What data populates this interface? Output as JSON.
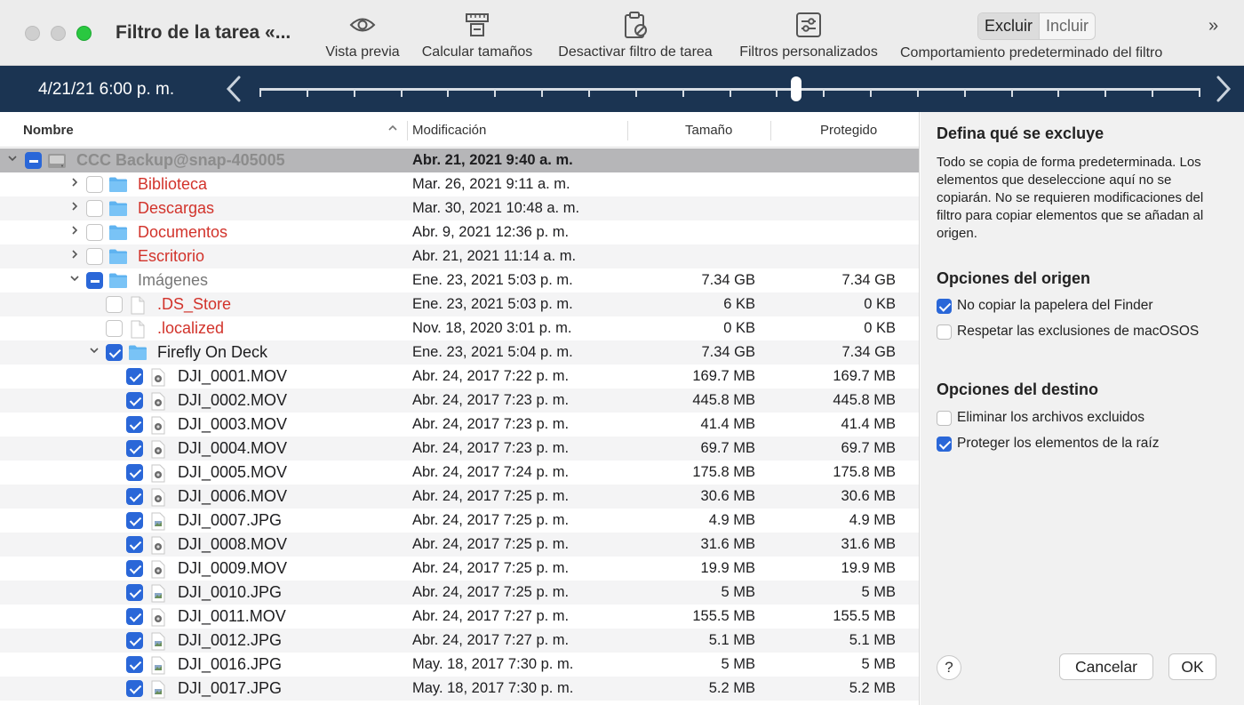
{
  "window": {
    "title": "Filtro de la tarea «..."
  },
  "toolbar": {
    "preview": "Vista previa",
    "calc_sizes": "Calcular tamaños",
    "disable_filter": "Desactivar filtro de tarea",
    "custom_filters": "Filtros personalizados",
    "exclude": "Excluir",
    "include": "Incluir",
    "default_behavior": "Comportamiento predeterminado del filtro"
  },
  "timeline": {
    "date": "4/21/21 6:00 p. m.",
    "position": 0.57
  },
  "columns": {
    "name": "Nombre",
    "modified": "Modificación",
    "size": "Tamaño",
    "protected": "Protegido"
  },
  "rows": [
    {
      "indent": 0,
      "disc": "down",
      "check": "mixed",
      "icon": "disk",
      "name": "CCC Backup@snap-405005",
      "date": "Abr. 21, 2021 9:40 a. m.",
      "size": "",
      "prot": "",
      "style": "disk",
      "sel": true
    },
    {
      "indent": 1,
      "disc": "right",
      "check": "none",
      "icon": "folder",
      "name": "Biblioteca",
      "date": "Mar. 26, 2021 9:11 a. m.",
      "size": "",
      "prot": "",
      "style": "red"
    },
    {
      "indent": 1,
      "disc": "right",
      "check": "none",
      "icon": "folder",
      "name": "Descargas",
      "date": "Mar. 30, 2021 10:48 a. m.",
      "size": "",
      "prot": "",
      "style": "red"
    },
    {
      "indent": 1,
      "disc": "right",
      "check": "none",
      "icon": "folder",
      "name": "Documentos",
      "date": "Abr. 9, 2021 12:36 p. m.",
      "size": "",
      "prot": "",
      "style": "red"
    },
    {
      "indent": 1,
      "disc": "right",
      "check": "none",
      "icon": "folder",
      "name": "Escritorio",
      "date": "Abr. 21, 2021 11:14 a. m.",
      "size": "",
      "prot": "",
      "style": "red"
    },
    {
      "indent": 1,
      "disc": "down",
      "check": "mixed",
      "icon": "folder",
      "name": "Imágenes",
      "date": "Ene. 23, 2021 5:03 p. m.",
      "size": "7.34 GB",
      "prot": "7.34 GB",
      "style": "grey"
    },
    {
      "indent": 2,
      "disc": "",
      "check": "none",
      "icon": "doc",
      "name": ".DS_Store",
      "date": "Ene. 23, 2021 5:03 p. m.",
      "size": "6 KB",
      "prot": "0 KB",
      "style": "red"
    },
    {
      "indent": 2,
      "disc": "",
      "check": "none",
      "icon": "doc",
      "name": ".localized",
      "date": "Nov. 18, 2020 3:01 p. m.",
      "size": "0 KB",
      "prot": "0 KB",
      "style": "red"
    },
    {
      "indent": 2,
      "disc": "down",
      "check": "checked",
      "icon": "folder",
      "name": "Firefly On Deck",
      "date": "Ene. 23, 2021 5:04 p. m.",
      "size": "7.34 GB",
      "prot": "7.34 GB",
      "style": "normal"
    },
    {
      "indent": 3,
      "disc": "",
      "check": "checked",
      "icon": "movie",
      "name": "DJI_0001.MOV",
      "date": "Abr. 24, 2017 7:22 p. m.",
      "size": "169.7 MB",
      "prot": "169.7 MB",
      "style": "normal"
    },
    {
      "indent": 3,
      "disc": "",
      "check": "checked",
      "icon": "movie",
      "name": "DJI_0002.MOV",
      "date": "Abr. 24, 2017 7:23 p. m.",
      "size": "445.8 MB",
      "prot": "445.8 MB",
      "style": "normal"
    },
    {
      "indent": 3,
      "disc": "",
      "check": "checked",
      "icon": "movie",
      "name": "DJI_0003.MOV",
      "date": "Abr. 24, 2017 7:23 p. m.",
      "size": "41.4 MB",
      "prot": "41.4 MB",
      "style": "normal"
    },
    {
      "indent": 3,
      "disc": "",
      "check": "checked",
      "icon": "movie",
      "name": "DJI_0004.MOV",
      "date": "Abr. 24, 2017 7:23 p. m.",
      "size": "69.7 MB",
      "prot": "69.7 MB",
      "style": "normal"
    },
    {
      "indent": 3,
      "disc": "",
      "check": "checked",
      "icon": "movie",
      "name": "DJI_0005.MOV",
      "date": "Abr. 24, 2017 7:24 p. m.",
      "size": "175.8 MB",
      "prot": "175.8 MB",
      "style": "normal"
    },
    {
      "indent": 3,
      "disc": "",
      "check": "checked",
      "icon": "movie",
      "name": "DJI_0006.MOV",
      "date": "Abr. 24, 2017 7:25 p. m.",
      "size": "30.6 MB",
      "prot": "30.6 MB",
      "style": "normal"
    },
    {
      "indent": 3,
      "disc": "",
      "check": "checked",
      "icon": "image",
      "name": "DJI_0007.JPG",
      "date": "Abr. 24, 2017 7:25 p. m.",
      "size": "4.9 MB",
      "prot": "4.9 MB",
      "style": "normal"
    },
    {
      "indent": 3,
      "disc": "",
      "check": "checked",
      "icon": "movie",
      "name": "DJI_0008.MOV",
      "date": "Abr. 24, 2017 7:25 p. m.",
      "size": "31.6 MB",
      "prot": "31.6 MB",
      "style": "normal"
    },
    {
      "indent": 3,
      "disc": "",
      "check": "checked",
      "icon": "movie",
      "name": "DJI_0009.MOV",
      "date": "Abr. 24, 2017 7:25 p. m.",
      "size": "19.9 MB",
      "prot": "19.9 MB",
      "style": "normal"
    },
    {
      "indent": 3,
      "disc": "",
      "check": "checked",
      "icon": "image",
      "name": "DJI_0010.JPG",
      "date": "Abr. 24, 2017 7:25 p. m.",
      "size": "5 MB",
      "prot": "5 MB",
      "style": "normal"
    },
    {
      "indent": 3,
      "disc": "",
      "check": "checked",
      "icon": "movie",
      "name": "DJI_0011.MOV",
      "date": "Abr. 24, 2017 7:27 p. m.",
      "size": "155.5 MB",
      "prot": "155.5 MB",
      "style": "normal"
    },
    {
      "indent": 3,
      "disc": "",
      "check": "checked",
      "icon": "image",
      "name": "DJI_0012.JPG",
      "date": "Abr. 24, 2017 7:27 p. m.",
      "size": "5.1 MB",
      "prot": "5.1 MB",
      "style": "normal"
    },
    {
      "indent": 3,
      "disc": "",
      "check": "checked",
      "icon": "image",
      "name": "DJI_0016.JPG",
      "date": "May. 18, 2017 7:30 p. m.",
      "size": "5 MB",
      "prot": "5 MB",
      "style": "normal"
    },
    {
      "indent": 3,
      "disc": "",
      "check": "checked",
      "icon": "image",
      "name": "DJI_0017.JPG",
      "date": "May. 18, 2017 7:30 p. m.",
      "size": "5.2 MB",
      "prot": "5.2 MB",
      "style": "normal"
    }
  ],
  "panel": {
    "heading": "Defina qué se excluye",
    "description": "Todo se copia de forma predeterminada. Los elementos que deseleccione aquí no se copiarán. No se requieren modificaciones del filtro para copiar elementos que se añadan al origen.",
    "source_heading": "Opciones del origen",
    "opt_trash": "No copiar la papelera del Finder",
    "opt_trash_checked": true,
    "opt_macos": "Respetar las exclusiones de macOSOS",
    "opt_macos_checked": false,
    "dest_heading": "Opciones del destino",
    "opt_delete": "Eliminar los archivos excluidos",
    "opt_delete_checked": false,
    "opt_protect": "Proteger los elementos de la raíz",
    "opt_protect_checked": true,
    "help": "?",
    "cancel": "Cancelar",
    "ok": "OK"
  },
  "colors": {
    "accent": "#2a67d8",
    "excluded": "#d2332b",
    "timeline_bg": "#1b3452"
  }
}
